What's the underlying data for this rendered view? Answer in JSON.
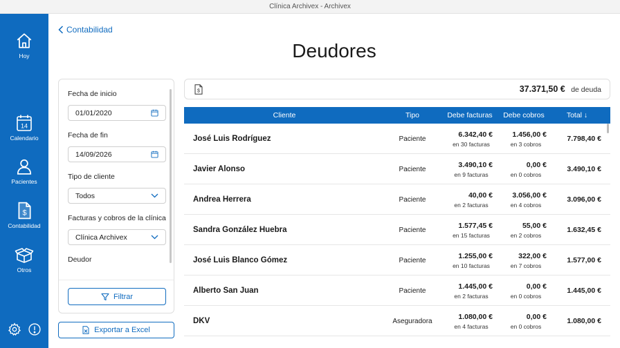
{
  "window": {
    "title": "Clínica Archivex - Archivex"
  },
  "sidebar": {
    "items": [
      {
        "label": "Hoy",
        "icon": "home-icon"
      },
      {
        "label": "Calendario",
        "icon": "calendar-icon",
        "badge": "14"
      },
      {
        "label": "Pacientes",
        "icon": "user-icon"
      },
      {
        "label": "Contabilidad",
        "icon": "invoice-icon"
      },
      {
        "label": "Otros",
        "icon": "box-icon"
      }
    ],
    "bottom_icons": [
      "gear-icon",
      "info-icon"
    ]
  },
  "breadcrumb": {
    "back_label": "Contabilidad"
  },
  "page": {
    "title": "Deudores"
  },
  "filters": {
    "start_label": "Fecha de inicio",
    "start_value": "01/01/2020",
    "end_label": "Fecha de fin",
    "end_value": "14/09/2026",
    "client_type_label": "Tipo de cliente",
    "client_type_value": "Todos",
    "clinic_label": "Facturas y cobros de la clínica",
    "clinic_value": "Clínica Archivex",
    "debtor_label": "Deudor",
    "filter_button": "Filtrar"
  },
  "export_button": "Exportar a Excel",
  "summary": {
    "amount": "37.371,50 €",
    "suffix": "de deuda"
  },
  "table": {
    "headers": {
      "client": "Cliente",
      "type": "Tipo",
      "invoices": "Debe facturas",
      "payments": "Debe cobros",
      "total": "Total ↓"
    },
    "rows": [
      {
        "name": "José Luis Rodríguez",
        "type": "Paciente",
        "inv": "6.342,40 €",
        "inv_sub": "en 30 facturas",
        "pay": "1.456,00 €",
        "pay_sub": "en 3 cobros",
        "total": "7.798,40 €"
      },
      {
        "name": "Javier Alonso",
        "type": "Paciente",
        "inv": "3.490,10 €",
        "inv_sub": "en 9 facturas",
        "pay": "0,00 €",
        "pay_sub": "en 0 cobros",
        "total": "3.490,10 €"
      },
      {
        "name": "Andrea Herrera",
        "type": "Paciente",
        "inv": "40,00 €",
        "inv_sub": "en 2 facturas",
        "pay": "3.056,00 €",
        "pay_sub": "en 4 cobros",
        "total": "3.096,00 €"
      },
      {
        "name": "Sandra González Huebra",
        "type": "Paciente",
        "inv": "1.577,45 €",
        "inv_sub": "en 15 facturas",
        "pay": "55,00 €",
        "pay_sub": "en 2 cobros",
        "total": "1.632,45 €"
      },
      {
        "name": "José Luis Blanco Gómez",
        "type": "Paciente",
        "inv": "1.255,00 €",
        "inv_sub": "en 10 facturas",
        "pay": "322,00 €",
        "pay_sub": "en 7 cobros",
        "total": "1.577,00 €"
      },
      {
        "name": "Alberto San Juan",
        "type": "Paciente",
        "inv": "1.445,00 €",
        "inv_sub": "en 2 facturas",
        "pay": "0,00 €",
        "pay_sub": "en 0 cobros",
        "total": "1.445,00 €"
      },
      {
        "name": "DKV",
        "type": "Aseguradora",
        "inv": "1.080,00 €",
        "inv_sub": "en 4 facturas",
        "pay": "0,00 €",
        "pay_sub": "en 0 cobros",
        "total": "1.080,00 €"
      }
    ]
  },
  "colors": {
    "primary": "#0f6bbf",
    "sidebar_bg": "#0f6bbf",
    "border": "#dedede"
  }
}
